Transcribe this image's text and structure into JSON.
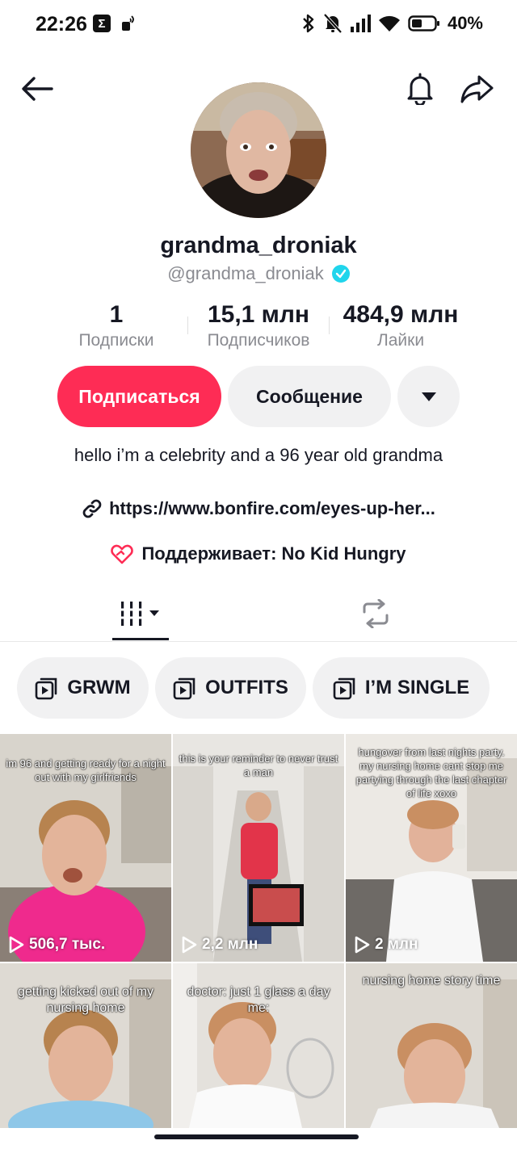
{
  "status_bar": {
    "time": "22:26",
    "battery_pct": "40%",
    "icons": [
      "sigma-icon",
      "sim-icon",
      "bluetooth-icon",
      "mute-icon",
      "signal-icon",
      "wifi-icon",
      "battery-icon"
    ]
  },
  "profile": {
    "username": "grandma_droniak",
    "handle": "@grandma_droniak",
    "verified": true,
    "stats": [
      {
        "value": "1",
        "label": "Подписки"
      },
      {
        "value": "15,1 млн",
        "label": "Подписчиков"
      },
      {
        "value": "484,9 млн",
        "label": "Лайки"
      }
    ],
    "follow_label": "Подписаться",
    "message_label": "Сообщение",
    "bio": "hello i’m a celebrity and a 96 year old grandma",
    "link": "https://www.bonfire.com/eyes-up-her...",
    "supports": "Поддерживает: No Kid Hungry"
  },
  "colors": {
    "accent": "#fe2c55",
    "verified": "#20d5ec",
    "chip_bg": "#f1f1f2",
    "text": "#161823",
    "muted": "#8a8b91"
  },
  "playlists": [
    {
      "label": "GRWM"
    },
    {
      "label": "OUTFITS"
    },
    {
      "label": "I’M SINGLE"
    }
  ],
  "videos": [
    {
      "caption": "im 96 and getting ready for a night out with my girlfriends",
      "views": "506,7 тыс."
    },
    {
      "caption": "this is your reminder to never trust a man",
      "views": "2,2 млн"
    },
    {
      "caption": "hungover from last nights party. my nursing home cant stop me partying through the last chapter of life xoxo",
      "views": "2 млн"
    },
    {
      "caption": "getting kicked out of my nursing home",
      "views": ""
    },
    {
      "caption": "doctor: just 1 glass a day me:",
      "views": ""
    },
    {
      "caption": "nursing home story time",
      "views": ""
    }
  ]
}
